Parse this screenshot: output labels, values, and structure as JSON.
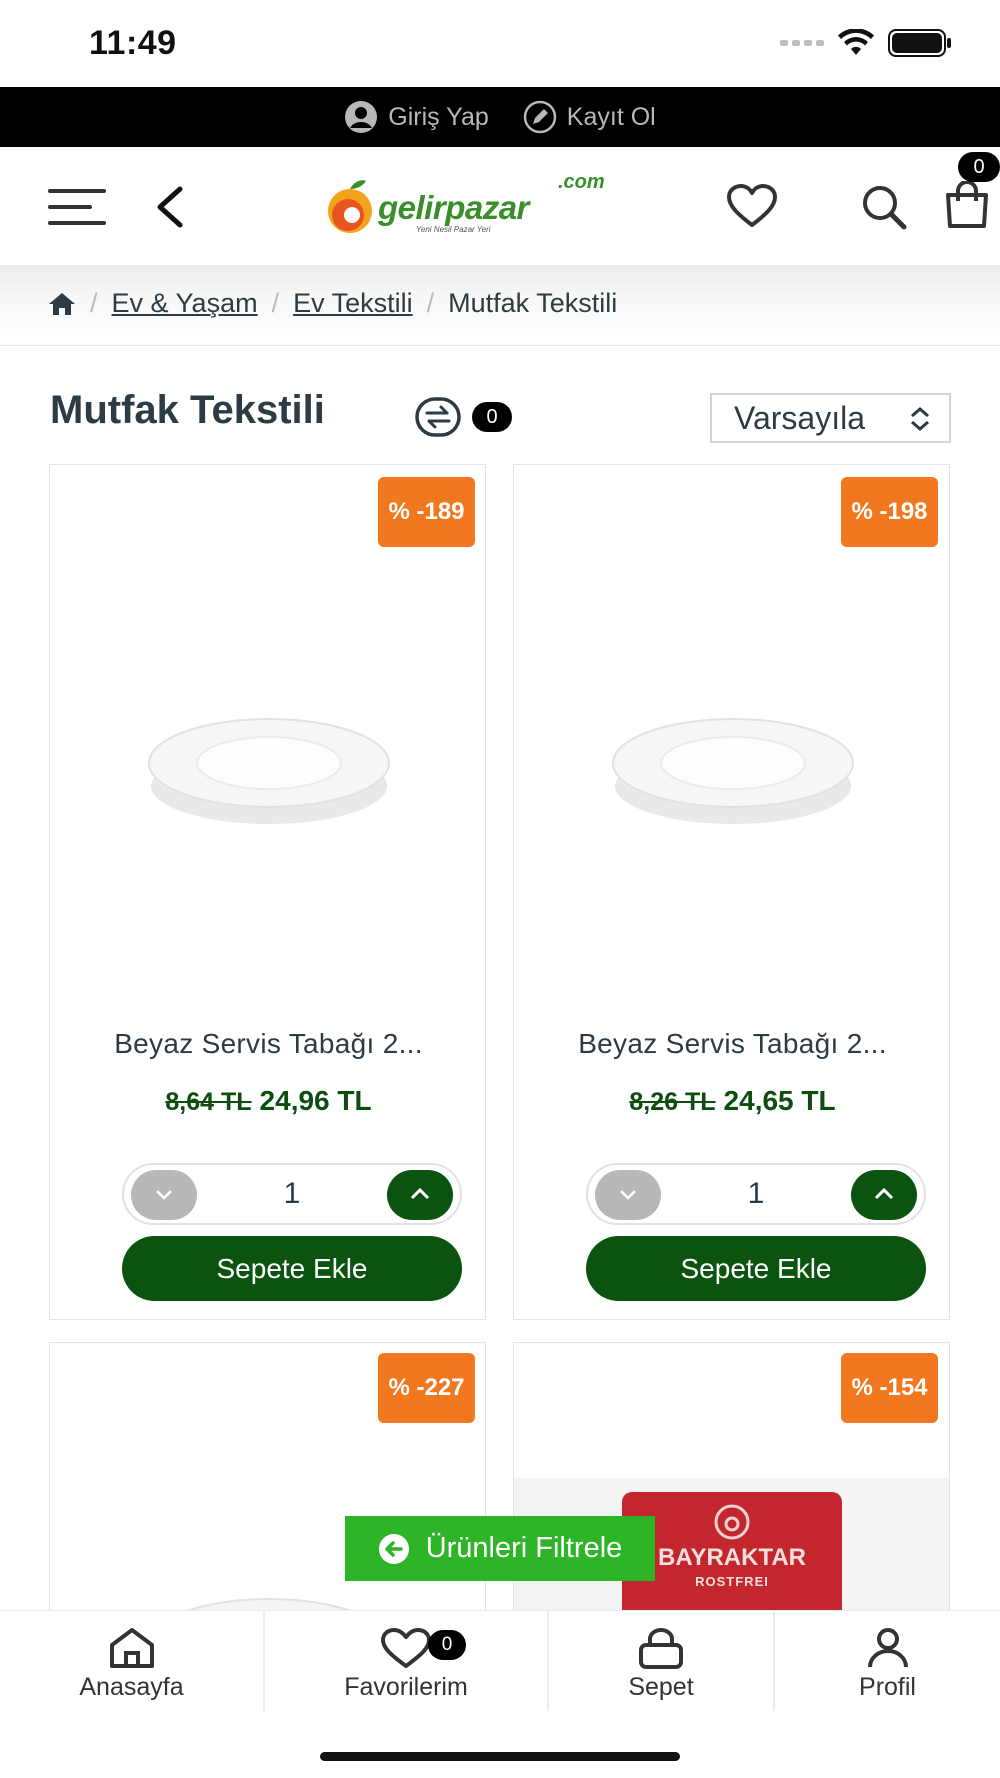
{
  "status_bar": {
    "time": "11:49"
  },
  "auth_bar": {
    "login_label": "Giriş Yap",
    "register_label": "Kayıt Ol"
  },
  "header": {
    "logo_main": "gelirpazar",
    "logo_domain": ".com",
    "logo_tagline": "Yeni Nesil Pazar Yeri",
    "cart_count": "0"
  },
  "breadcrumb": {
    "items": [
      "Ev & Yaşam",
      "Ev Tekstili",
      "Mutfak Tekstili"
    ]
  },
  "page": {
    "title": "Mutfak Tekstili",
    "compare_count": "0",
    "sort_selected": "Varsayıla"
  },
  "products": [
    {
      "badge": "% -189",
      "name": "Beyaz Servis Tabağı 2...",
      "old_price": "8,64 TL",
      "price": "24,96 TL",
      "quantity": "1",
      "add_label": "Sepete Ekle"
    },
    {
      "badge": "% -198",
      "name": "Beyaz Servis Tabağı 2...",
      "old_price": "8,26 TL",
      "price": "24,65 TL",
      "quantity": "1",
      "add_label": "Sepete Ekle"
    },
    {
      "badge": "% -227"
    },
    {
      "badge": "% -154",
      "image_text_1": "BAYRAKTAR",
      "image_text_2": "ROSTFREI"
    }
  ],
  "filter_button": {
    "label": "Ürünleri Filtrele"
  },
  "bottom_nav": {
    "items": [
      {
        "label": "Anasayfa",
        "icon": "home-icon"
      },
      {
        "label": "Favorilerim",
        "icon": "heart-icon"
      },
      {
        "label": "Sepet",
        "icon": "lock-bag-icon"
      },
      {
        "label": "Profil",
        "icon": "user-icon"
      }
    ],
    "favorites_count": "0"
  },
  "colors": {
    "brand_green": "#0b5410",
    "badge_orange": "#f1781e",
    "filter_green": "#2db427"
  }
}
